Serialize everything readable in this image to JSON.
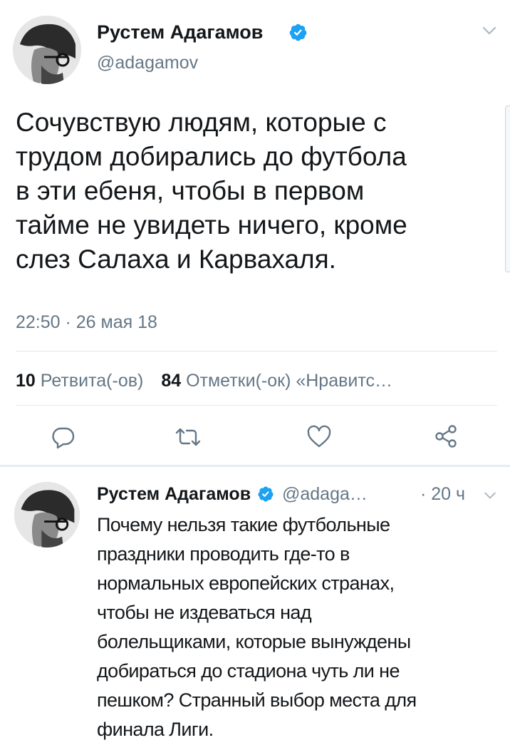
{
  "tweet": {
    "author_name": "Рустем Адагамов",
    "author_handle": "@adagamov",
    "text": "Сочувствую людям, которые с трудом добирались до футбола в эти ебеня, чтобы в первом тайме не увидеть ничего, кроме слез Салаха и Карвахаля.",
    "lines": [
      "Сочувствую людям, которые с",
      "трудом добирались до футбола",
      "в эти ебеня, чтобы в первом",
      "тайме не увидеть ничего, кроме",
      "слез Салаха и Карвахаля."
    ],
    "timestamp": "22:50 · 26 мая 18",
    "retweets_count": "10",
    "retweets_label": "Ретвита(-ов)",
    "likes_count": "84",
    "likes_label": "Отметки(-ок) «Нравитс…",
    "actions": {
      "reply_icon": "reply-icon",
      "retweet_icon": "retweet-icon",
      "like_icon": "heart-icon",
      "share_icon": "share-icon"
    }
  },
  "reply": {
    "author_name": "Рустем Адагамов",
    "author_handle": "@adaga…",
    "time": "· 20 ч",
    "lines": [
      "Почему нельзя такие футбольные",
      "праздники проводить где-то в",
      "нормальных европейских странах,",
      "чтобы не издеваться над",
      "болельщиками, которые вынуждены",
      "добираться до стадиона чуть ли не",
      "пешком? Странный выбор места для",
      "финала Лиги."
    ]
  },
  "colors": {
    "verified": "#1da1f2",
    "muted": "#657786",
    "divider": "#e1e8ed",
    "text": "#14171a"
  }
}
